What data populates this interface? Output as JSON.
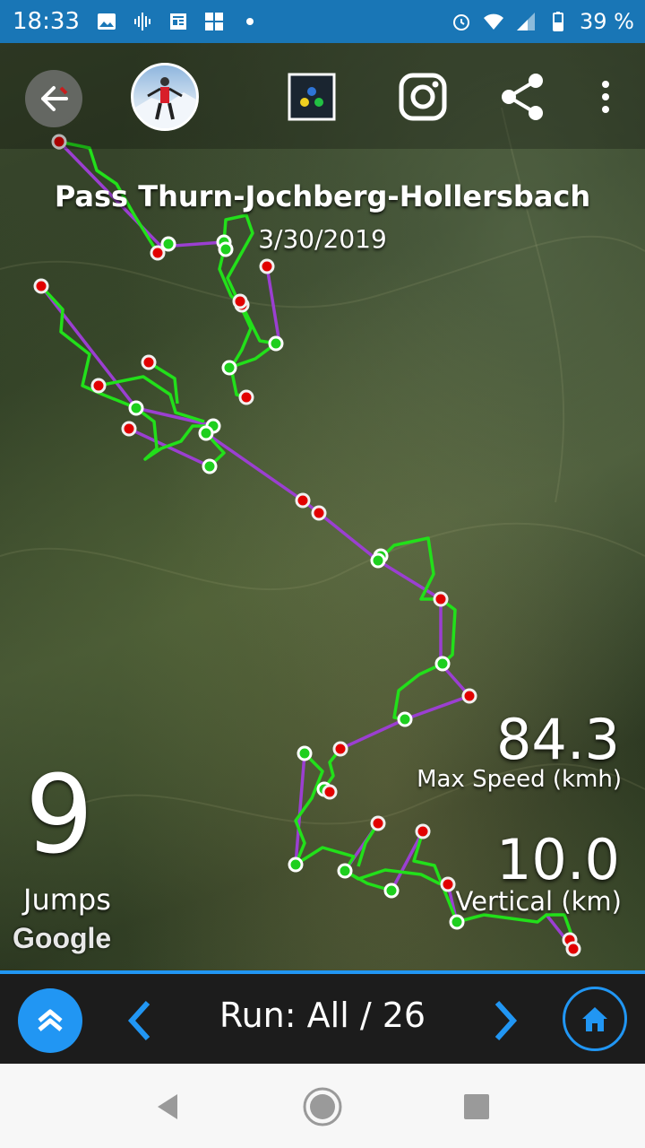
{
  "status_bar": {
    "time": "18:33",
    "battery": "39 %",
    "icons": [
      "image-icon",
      "podcast-icon",
      "news-icon",
      "photo-collage-icon",
      "dot-icon",
      "alarm-icon",
      "wifi-icon",
      "signal-icon",
      "battery-icon"
    ]
  },
  "header": {
    "title": "Pass Thurn-Jochberg-Hollersbach",
    "date": "3/30/2019",
    "icons": [
      "back-arrow-icon",
      "avatar",
      "app-grid-icon",
      "instagram-icon",
      "share-icon",
      "more-vert-icon"
    ]
  },
  "stats": {
    "jumps_value": "9",
    "jumps_label": "Jumps",
    "speed_value": "84.3",
    "speed_label": "Max Speed (kmh)",
    "vertical_value": "10.0",
    "vertical_label": "Vertical (km)"
  },
  "map": {
    "attribution": "Google",
    "colors": {
      "lift": "#9b3fd1",
      "run": "#22e01a",
      "start": "#e10000",
      "end": "#1ecf1e"
    }
  },
  "bottom_bar": {
    "run_label": "Run: All / 26",
    "accent": "#2196f3",
    "icons": [
      "double-chevron-up-icon",
      "chevron-left-icon",
      "chevron-right-icon",
      "home-icon"
    ]
  },
  "system_nav": {
    "icons": [
      "back-triangle-icon",
      "home-circle-icon",
      "recents-square-icon"
    ]
  }
}
